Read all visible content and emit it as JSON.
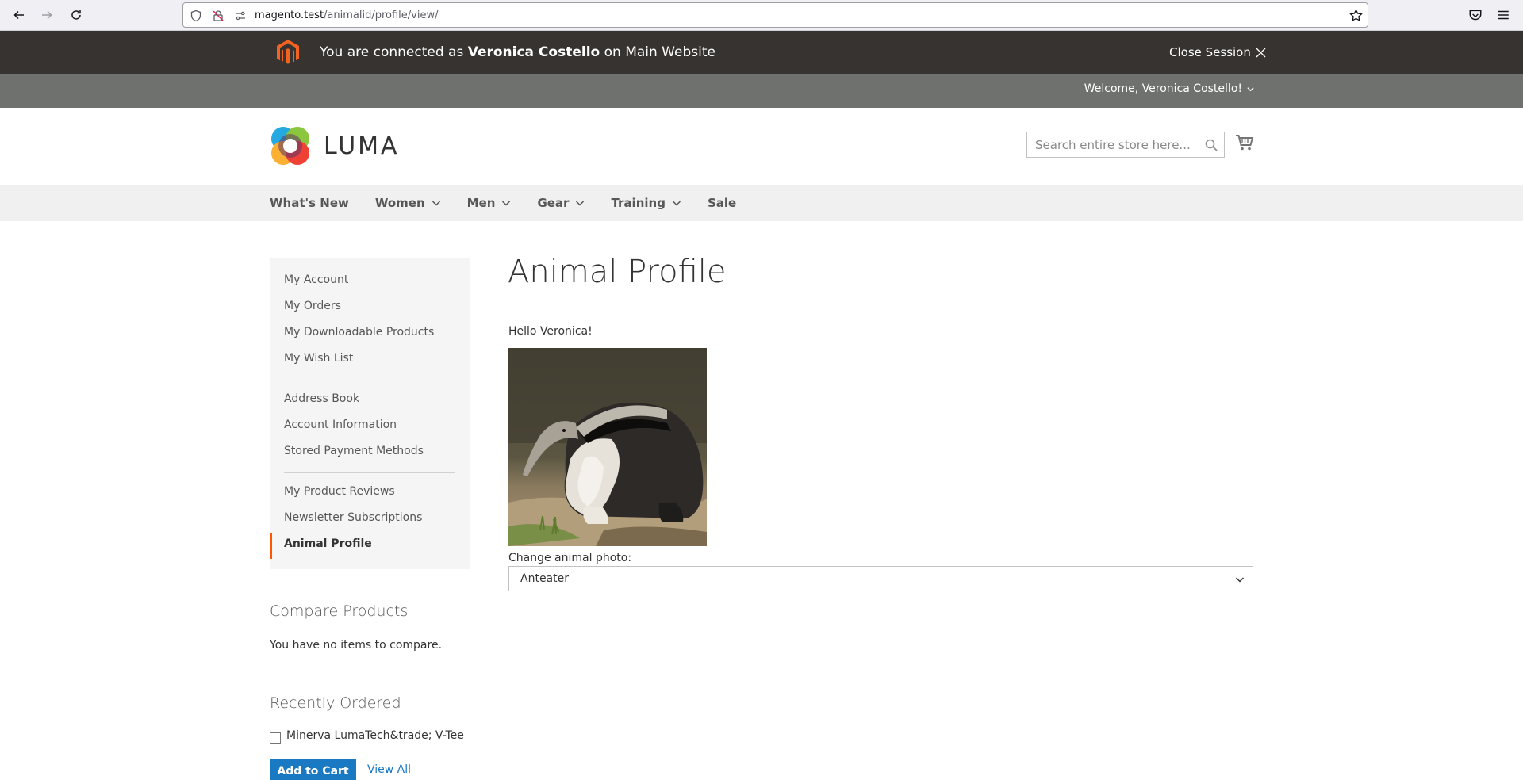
{
  "browser": {
    "url_host": "magento.test",
    "url_path": "/animalid/profile/view/"
  },
  "admin_bar": {
    "prefix": "You are connected as",
    "customer_name": "Veronica Costello",
    "suffix": "on Main Website",
    "close_session": "Close Session"
  },
  "panel": {
    "welcome": "Welcome, Veronica Costello!"
  },
  "header": {
    "logo_text": "LUMA",
    "search_placeholder": "Search entire store here..."
  },
  "nav": {
    "items": [
      {
        "label": "What's New",
        "has_dropdown": false
      },
      {
        "label": "Women",
        "has_dropdown": true
      },
      {
        "label": "Men",
        "has_dropdown": true
      },
      {
        "label": "Gear",
        "has_dropdown": true
      },
      {
        "label": "Training",
        "has_dropdown": true
      },
      {
        "label": "Sale",
        "has_dropdown": false
      }
    ]
  },
  "sidebar": {
    "items": [
      {
        "label": "My Account"
      },
      {
        "label": "My Orders"
      },
      {
        "label": "My Downloadable Products"
      },
      {
        "label": "My Wish List"
      },
      {
        "label": "Address Book"
      },
      {
        "label": "Account Information"
      },
      {
        "label": "Stored Payment Methods"
      },
      {
        "label": "My Product Reviews"
      },
      {
        "label": "Newsletter Subscriptions"
      },
      {
        "label": "Animal Profile",
        "active": true
      }
    ],
    "compare": {
      "title": "Compare Products",
      "empty_text": "You have no items to compare."
    },
    "recently_ordered": {
      "title": "Recently Ordered",
      "item_label": "Minerva LumaTech&trade; V-Tee",
      "add_to_cart": "Add to Cart",
      "view_all": "View All"
    }
  },
  "main": {
    "title": "Animal Profile",
    "greeting": "Hello Veronica!",
    "change_label": "Change animal photo:",
    "selected_animal": "Anteater"
  },
  "colors": {
    "admin_bar": "#373330",
    "panel": "#6e716e",
    "nav_bg": "#f0f0f0",
    "sidebar_bg": "#f5f5f5",
    "active_accent": "#ff5501",
    "button_blue": "#1979c3"
  }
}
